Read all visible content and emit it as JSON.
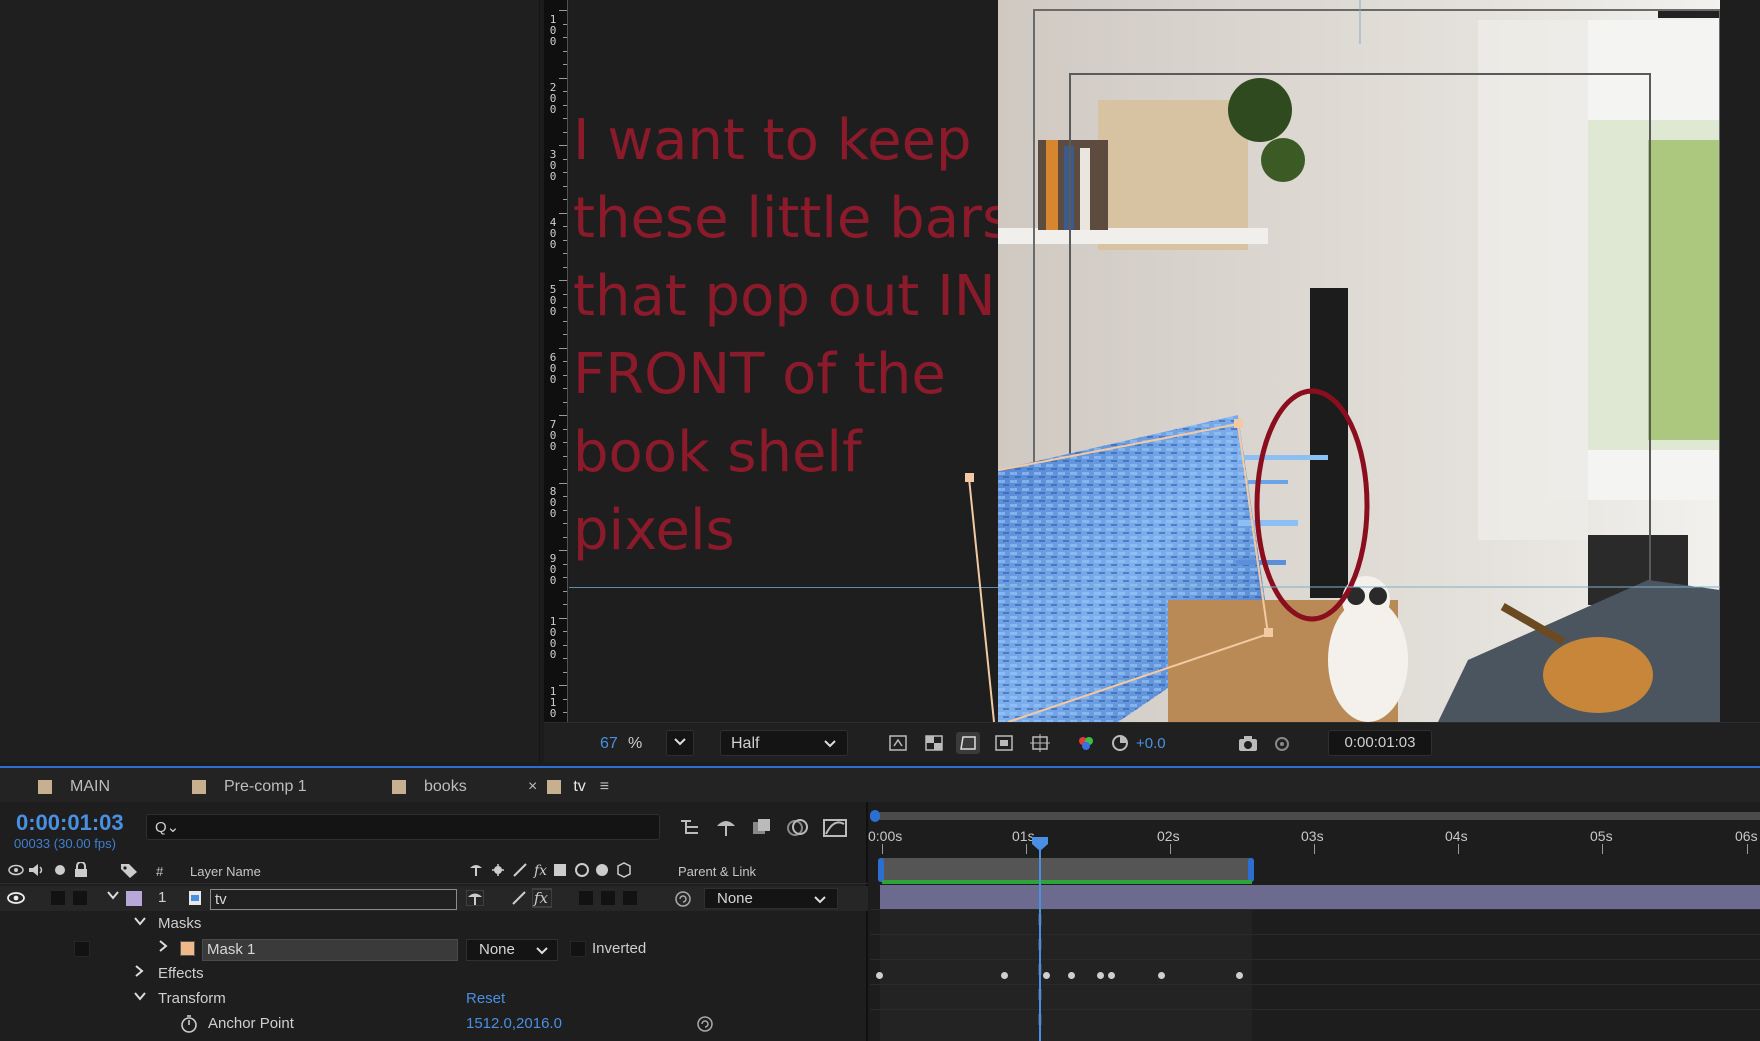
{
  "viewer": {
    "ruler_labels": [
      "1\n0\n0",
      "2\n0\n0",
      "3\n0\n0",
      "4\n0\n0",
      "5\n0\n0",
      "6\n0\n0",
      "7\n0\n0",
      "8\n0\n0",
      "9\n0\n0",
      "1\n0\n0\n0",
      "1\n1\n0"
    ],
    "note": "I want to keep these little bars that pop out IN FRONT of the book shelf pixels",
    "note_color": "#8b1a2a",
    "toolbar": {
      "zoom_value": "67",
      "zoom_unit": "%",
      "resolution": "Half",
      "exposure": "+0.0",
      "timecode": "0:00:01:03"
    }
  },
  "tabs": [
    {
      "label": "MAIN"
    },
    {
      "label": "Pre-comp 1"
    },
    {
      "label": "books"
    },
    {
      "label": "tv",
      "close": "×",
      "menu": "≡"
    }
  ],
  "timeline": {
    "current_time": "0:00:01:03",
    "current_frames": "00033 (30.00 fps)",
    "search_icon": "Q⌄",
    "columns": {
      "number": "#",
      "layer_name": "Layer Name",
      "parent_link": "Parent & Link"
    },
    "layer": {
      "number": "1",
      "name": "tv",
      "parent": "None"
    },
    "masks_label": "Masks",
    "mask": {
      "name": "Mask 1",
      "mode": "None",
      "inverted_label": "Inverted"
    },
    "effects_label": "Effects",
    "transform": {
      "label": "Transform",
      "reset": "Reset"
    },
    "anchor_point": {
      "label": "Anchor Point",
      "value": "1512.0,2016.0"
    },
    "time_ruler": [
      "0:00s",
      "01s",
      "02s",
      "03s",
      "04s",
      "05s",
      "06s"
    ],
    "accent_color": "#4a90e2"
  }
}
